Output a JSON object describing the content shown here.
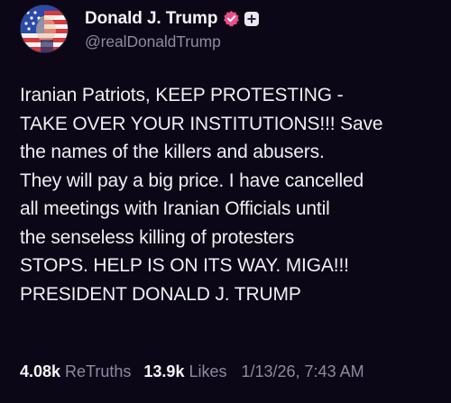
{
  "author": {
    "display_name": "Donald J. Trump",
    "handle": "@realDonaldTrump",
    "avatar_icon": "flag-portrait-avatar",
    "verified_icon": "verified-badge-icon",
    "subscription_icon": "plus-badge-icon",
    "verified_color": "#e94f8a"
  },
  "post": {
    "lines": [
      "Iranian Patriots, KEEP PROTESTING -",
      "TAKE OVER YOUR INSTITUTIONS!!! Save",
      "the names of the killers and abusers.",
      "They will pay a big price. I have cancelled",
      "all meetings with Iranian Officials until",
      "the senseless killing of protesters",
      "STOPS. HELP IS ON ITS WAY. MIGA!!!",
      "PRESIDENT DONALD J. TRUMP"
    ]
  },
  "stats": {
    "retruths_count": "4.08k",
    "retruths_label": "ReTruths",
    "likes_count": "13.9k",
    "likes_label": "Likes",
    "timestamp": "1/13/26, 7:43 AM"
  },
  "colors": {
    "background": "#0b0716",
    "text": "#f0eff4",
    "muted": "#8e8aa0"
  }
}
